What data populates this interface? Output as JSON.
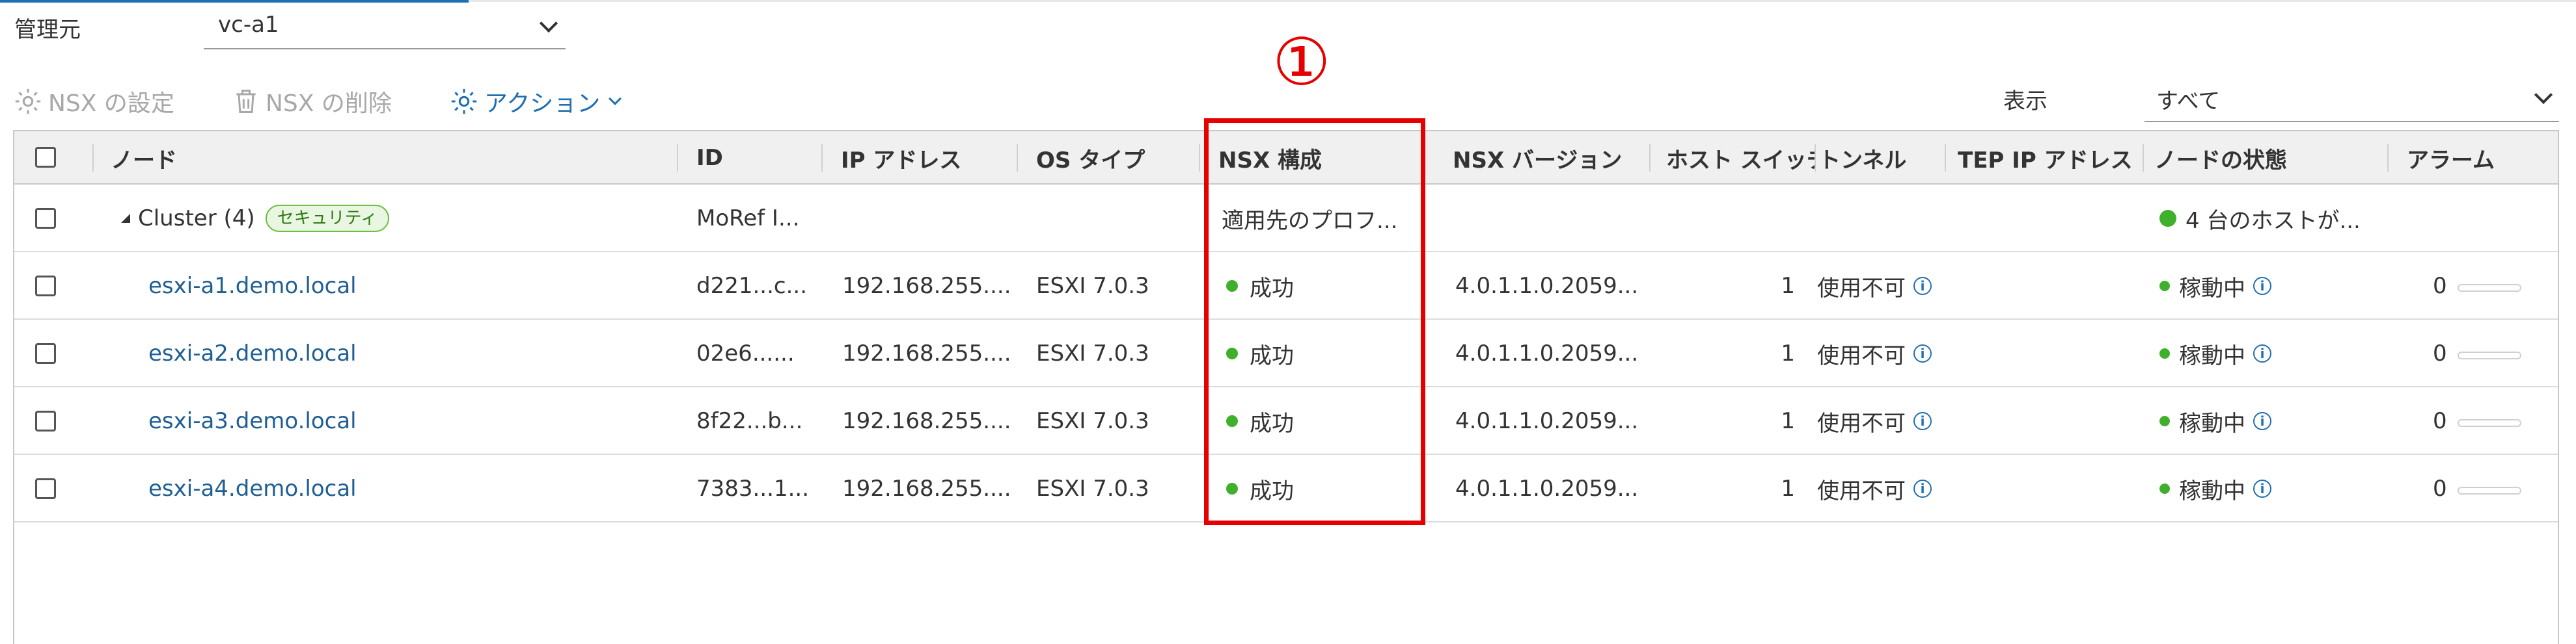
{
  "manager": {
    "label": "管理元",
    "value": "vc-a1"
  },
  "annotation": {
    "marker": "①"
  },
  "toolbar": {
    "nsx_settings": "NSX の設定",
    "nsx_delete": "NSX の削除",
    "actions": "アクション"
  },
  "view": {
    "label": "表示",
    "value": "すべて"
  },
  "table": {
    "headers": {
      "node": "ノード",
      "id": "ID",
      "ip": "IP アドレス",
      "os": "OS タイプ",
      "nsx_config": "NSX 構成",
      "nsx_version": "NSX バージョン",
      "host_switch": "ホスト スイッチ",
      "tunnel": "トンネル",
      "tep_ip": "TEP IP アドレス",
      "node_status": "ノードの状態",
      "alarm": "アラーム"
    },
    "cluster": {
      "name": "Cluster (4)",
      "badge": "セキュリティ",
      "id": "MoRef I...",
      "nsx_config": "適用先のプロフ...",
      "node_status": "4 台のホストが..."
    },
    "rows": [
      {
        "node": "esxi-a1.demo.local",
        "id": "d221...c...",
        "ip": "192.168.255....",
        "os": "ESXI 7.0.3",
        "nsx_config": "成功",
        "nsx_version": "4.0.1.1.0.2059...",
        "host_switch": "1",
        "tunnel": "使用不可",
        "node_status": "稼動中",
        "alarm": "0"
      },
      {
        "node": "esxi-a2.demo.local",
        "id": "02e6......",
        "ip": "192.168.255....",
        "os": "ESXI 7.0.3",
        "nsx_config": "成功",
        "nsx_version": "4.0.1.1.0.2059...",
        "host_switch": "1",
        "tunnel": "使用不可",
        "node_status": "稼動中",
        "alarm": "0"
      },
      {
        "node": "esxi-a3.demo.local",
        "id": "8f22...b...",
        "ip": "192.168.255....",
        "os": "ESXI 7.0.3",
        "nsx_config": "成功",
        "nsx_version": "4.0.1.1.0.2059...",
        "host_switch": "1",
        "tunnel": "使用不可",
        "node_status": "稼動中",
        "alarm": "0"
      },
      {
        "node": "esxi-a4.demo.local",
        "id": "7383...1...",
        "ip": "192.168.255....",
        "os": "ESXI 7.0.3",
        "nsx_config": "成功",
        "nsx_version": "4.0.1.1.0.2059...",
        "host_switch": "1",
        "tunnel": "使用不可",
        "node_status": "稼動中",
        "alarm": "0"
      }
    ]
  },
  "colors": {
    "accent": "#1f6fb2",
    "success": "#3fb02b",
    "annotation": "#e60000"
  }
}
